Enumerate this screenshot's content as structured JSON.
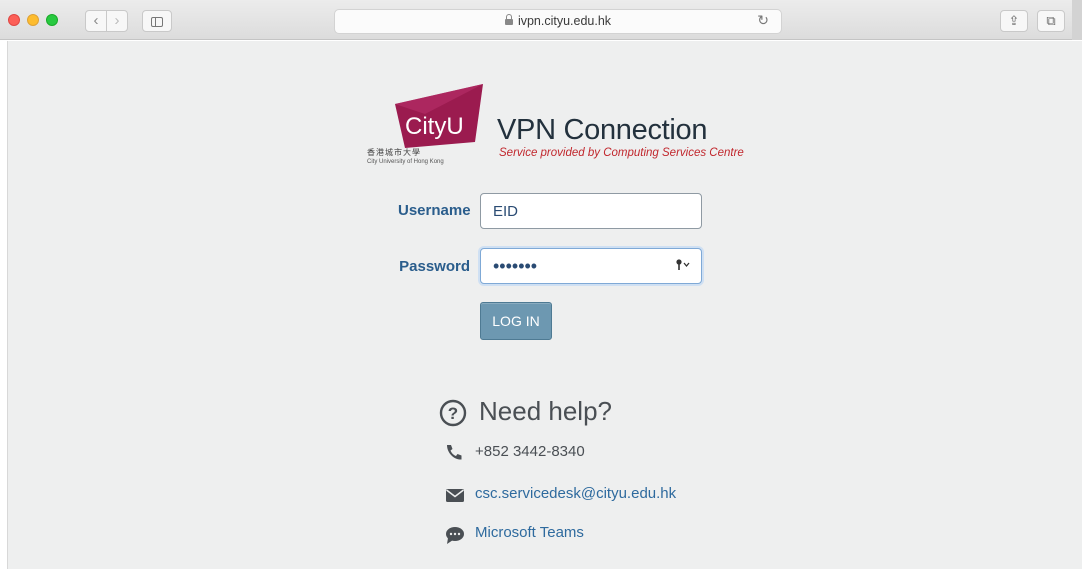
{
  "browser": {
    "address": "ivpn.cityu.edu.hk",
    "nav_back": "‹",
    "nav_forward": "›",
    "reload": "↻",
    "share": "⇪",
    "tabs": "⧉"
  },
  "brand": {
    "logo_text": "CityU",
    "logo_chinese": "香港城市大學",
    "logo_english": "City University of Hong Kong",
    "logo_color": "#9b1b4f",
    "title": "VPN Connection",
    "subtitle": "Service provided by Computing Services Centre"
  },
  "form": {
    "username_label": "Username",
    "username_value": "EID",
    "password_label": "Password",
    "password_mask": "•••••••",
    "login_label": "LOG IN",
    "accent": "#6d98b1"
  },
  "help": {
    "title": "Need help?",
    "phone": "+852 3442-8340",
    "email": "csc.servicedesk@cityu.edu.hk",
    "chat": "Microsoft Teams"
  }
}
